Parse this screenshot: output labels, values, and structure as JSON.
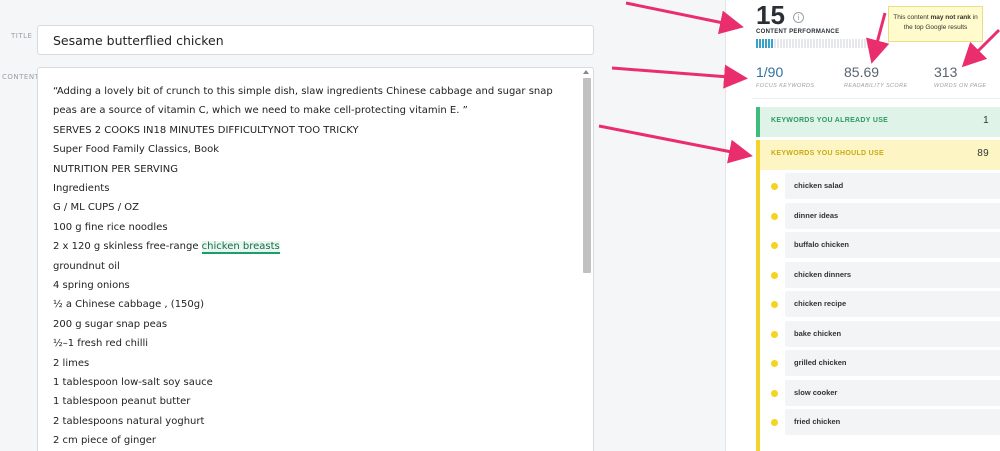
{
  "editor": {
    "title_label": "TITLE",
    "content_label": "CONTENT",
    "title_value": "Sesame butterflied chicken",
    "content": {
      "intro": "“Adding a lovely bit of crunch to this simple dish, slaw ingredients Chinese cabbage and sugar snap peas are a source of vitamin C, which we need to make cell-protecting vitamin E. ”",
      "lines": [
        "SERVES 2 COOKS IN18 MINUTES DIFFICULTYNOT TOO TRICKY",
        "Super Food Family Classics, Book",
        "NUTRITION PER SERVING",
        "Ingredients",
        "G / ML  CUPS / OZ",
        "100 g fine rice noodles"
      ],
      "highlight_prefix": "2 x 120 g skinless free-range ",
      "highlight_keyword": "chicken breasts",
      "lines_after": [
        "groundnut oil",
        "4 spring onions",
        "½ a Chinese cabbage , (150g)",
        "200 g sugar snap peas",
        "½–1 fresh red chilli",
        "2 limes",
        "1 tablespoon low-salt soy sauce",
        "1 tablespoon peanut butter",
        "2 tablespoons natural yoghurt",
        "2 cm piece of ginger"
      ]
    }
  },
  "panel": {
    "score": "15",
    "info_icon": "info-icon",
    "score_label": "CONTENT PERFORMANCE",
    "score_fraction": 0.15,
    "tooltip_pre": "This content ",
    "tooltip_bold1": "may not rank",
    "tooltip_mid": " in the top Google results",
    "metrics": [
      {
        "value": "1/90",
        "label": "FOCUS KEYWORDS"
      },
      {
        "value": "85.69",
        "label": "READABILITY SCORE"
      },
      {
        "value": "313",
        "label": "WORDS ON PAGE"
      }
    ],
    "already_use": {
      "label": "KEYWORDS YOU ALREADY USE",
      "count": "1"
    },
    "should_use": {
      "label": "KEYWORDS YOU SHOULD USE",
      "count": "89"
    },
    "keywords": [
      "chicken salad",
      "dinner ideas",
      "buffalo chicken",
      "chicken dinners",
      "chicken recipe",
      "bake chicken",
      "grilled chicken",
      "slow cooker",
      "fried chicken"
    ],
    "colors": {
      "accent_green": "#3dbc7c",
      "accent_yellow": "#f1d331",
      "arrow": "#ea2d6d",
      "bar_blue": "#38a3c9"
    }
  }
}
